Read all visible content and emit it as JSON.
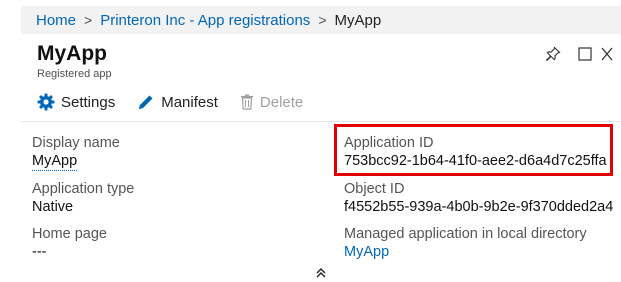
{
  "breadcrumb": {
    "items": [
      "Home",
      "Printeron Inc - App registrations",
      "MyApp"
    ],
    "separator": ">"
  },
  "header": {
    "title": "MyApp",
    "subtitle": "Registered app"
  },
  "window_controls": {
    "icons": [
      "pin-icon",
      "maximize-icon",
      "close-icon"
    ]
  },
  "toolbar": {
    "settings_label": "Settings",
    "manifest_label": "Manifest",
    "delete_label": "Delete"
  },
  "properties": {
    "display_name": {
      "label": "Display name",
      "value": "MyApp"
    },
    "application_type": {
      "label": "Application type",
      "value": "Native"
    },
    "home_page": {
      "label": "Home page",
      "value": "---"
    },
    "application_id": {
      "label": "Application ID",
      "value": "753bcc92-1b64-41f0-aee2-d6a4d7c25ffa"
    },
    "object_id": {
      "label": "Object ID",
      "value": "f4552b55-939a-4b0b-9b2e-9f370dded2a4"
    },
    "managed_app": {
      "label": "Managed application in local directory",
      "value": "MyApp"
    }
  },
  "colors": {
    "accent": "#0067b8",
    "highlight": "#e00000",
    "disabled": "#a0a0a0"
  }
}
